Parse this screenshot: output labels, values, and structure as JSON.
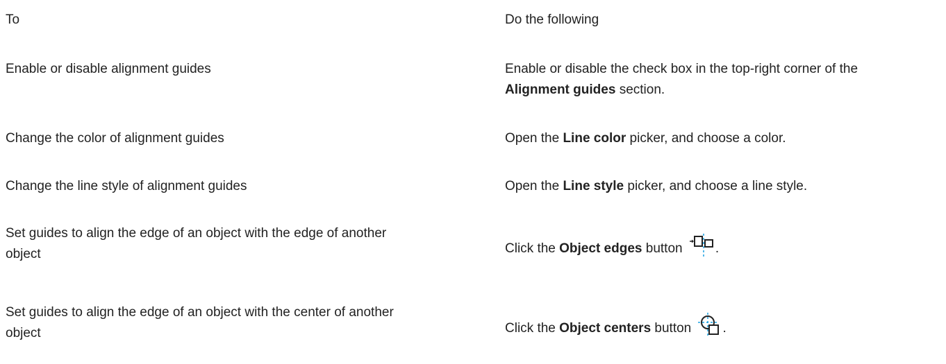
{
  "table": {
    "header": {
      "to": "To",
      "do": "Do the following"
    },
    "rows": [
      {
        "to": "Enable or disable alignment guides",
        "do_before": "Enable or disable the check box in the top-right corner of the",
        "do_bold": "Alignment guides",
        "do_after": "section."
      },
      {
        "to": "Change the color of alignment guides",
        "do_before": "Open the",
        "do_bold": "Line color",
        "do_after": "picker, and choose a color."
      },
      {
        "to": "Change the line style of alignment guides",
        "do_before": "Open the",
        "do_bold": "Line style",
        "do_after": "picker, and choose a line style."
      },
      {
        "to_line1": "Set guides to align the edge of an object with the edge of another",
        "to_line2": "object",
        "do_before": "Click the",
        "do_bold": "Object edges",
        "do_after": "button",
        "icon": "object-edges-icon"
      },
      {
        "to_line1": "Set guides to align the edge of an object with the center of another",
        "to_line2": "object",
        "do_before": "Click the",
        "do_bold": "Object centers",
        "do_after": "button",
        "icon": "object-centers-icon"
      }
    ]
  },
  "colors": {
    "text": "#222222",
    "guide_blue": "#1a9fe0"
  }
}
